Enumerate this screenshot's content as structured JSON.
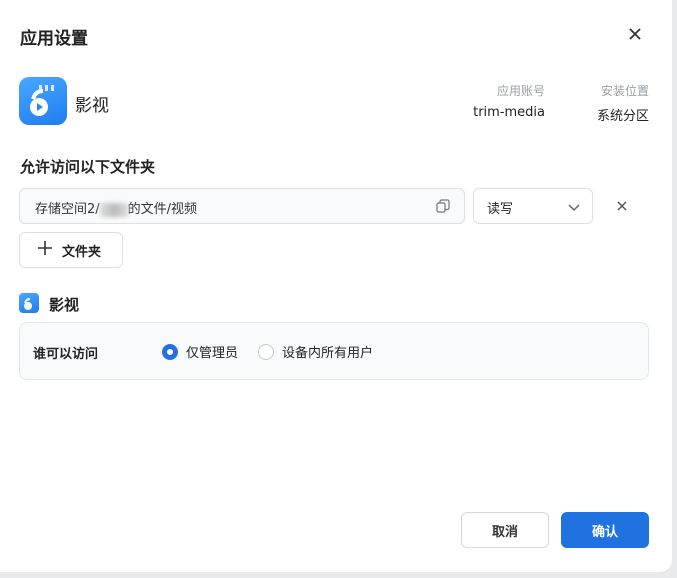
{
  "dialog": {
    "title": "应用设置"
  },
  "app": {
    "name": "影视",
    "account_label": "应用账号",
    "account_value": "trim-media",
    "location_label": "安装位置",
    "location_value": "系统分区"
  },
  "folders": {
    "section_title": "允许访问以下文件夹",
    "path_prefix": "存储空间2/",
    "path_suffix": "的文件/视频",
    "permission": "读写",
    "add_label": "文件夹"
  },
  "access": {
    "app_name": "影视",
    "label": "谁可以访问",
    "options": [
      {
        "label": "仅管理员",
        "selected": true
      },
      {
        "label": "设备内所有用户",
        "selected": false
      }
    ]
  },
  "footer": {
    "cancel": "取消",
    "confirm": "确认"
  },
  "colors": {
    "accent": "#1f72e0"
  }
}
